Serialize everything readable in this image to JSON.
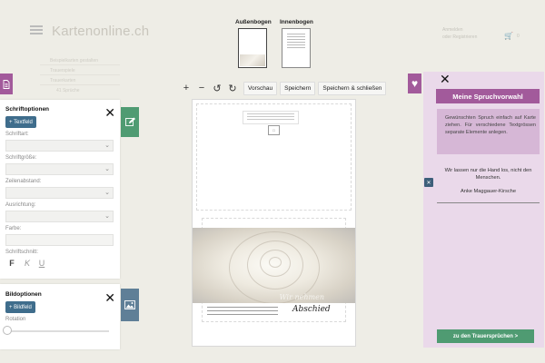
{
  "site": {
    "logo": "Kartenonline.ch",
    "account_label": "Anmelden",
    "account_sub": "oder Registrieren",
    "cart_count": "0",
    "bg_links": [
      "Beispielkarten gestalten",
      "Trauerspiele",
      "Trauerkarten",
      "41 Sprüche"
    ]
  },
  "pages": {
    "outer_label": "Außenbogen",
    "inner_label": "Innenbogen"
  },
  "toolbar": {
    "preview": "Vorschau",
    "save": "Speichern",
    "save_close": "Speichern & schließen"
  },
  "card": {
    "photo_title": "Wir nehmen",
    "farewell": "Abschied"
  },
  "text_options": {
    "title": "Schriftoptionen",
    "add_label": "Textfeld",
    "font_label": "Schriftart:",
    "size_label": "Schriftgröße:",
    "spacing_label": "Zeilenabstand:",
    "align_label": "Ausrichtung:",
    "color_label": "Farbe:",
    "style_label": "Schriftschnitt:",
    "bold": "F",
    "italic": "K",
    "underline": "U"
  },
  "image_options": {
    "title": "Bildoptionen",
    "add_label": "Bildfeld",
    "rotation_label": "Rotation",
    "rotation_value": 0
  },
  "sayings": {
    "title": "Meine Spruchvorwahl",
    "info": "Gewünschten Spruch einfach auf Karte ziehen. Für verschiedene Textgrössen separate Elemente anlegen.",
    "quote": "Wir lassen nur die Hand los, nicht den Menschen.",
    "author": "Anke Maggauer-Kirsche",
    "footer_button": "zu den Trauersprüchen  >"
  },
  "colors": {
    "purple": "#a25a9b",
    "green": "#4f9b72",
    "blue": "#3f6d8c",
    "panel_pink": "#ead9ea"
  }
}
